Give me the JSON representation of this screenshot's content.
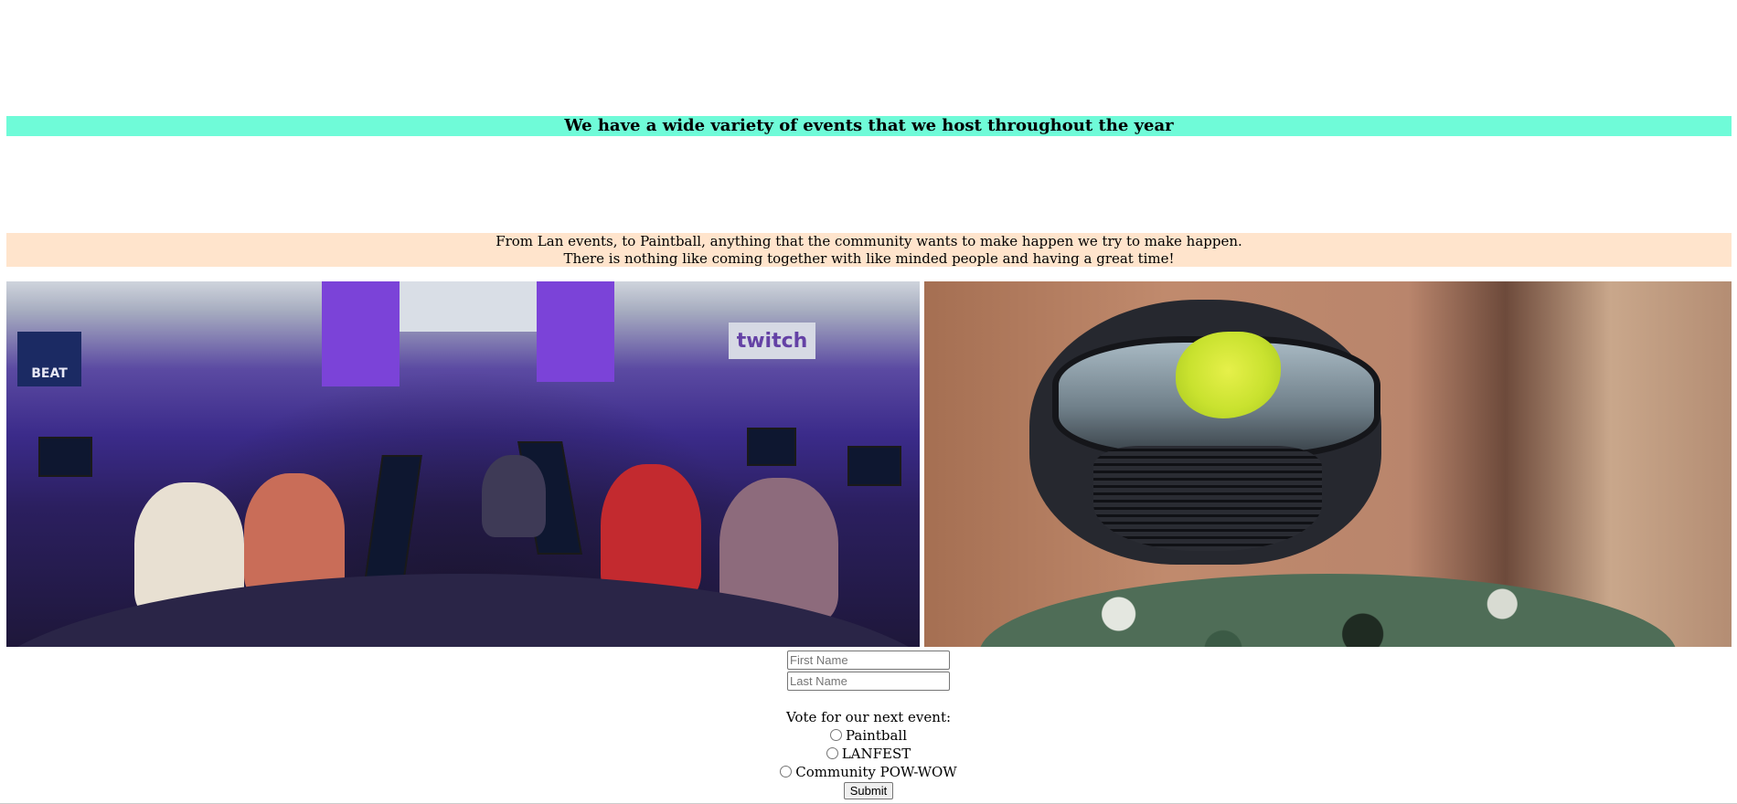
{
  "events": {
    "heading": "We have a wide variety of events that we host throughout the year",
    "intro_line_1": "From Lan events, to Paintball, anything that the community wants to make happen we try to make happen.",
    "intro_line_2": "There is nothing like coming together with like minded people and having a great time!",
    "heading_bg": "#6ffbd8",
    "intro_bg": "#ffe4cc"
  },
  "images": {
    "lan_photo": {
      "sign_twitch": "twitch",
      "sign_beat": "BEAT"
    },
    "paintball_photo": {}
  },
  "form": {
    "first_name_placeholder": "First Name",
    "last_name_placeholder": "Last Name",
    "question": "Vote for our next event:",
    "options": [
      "Paintball",
      "LANFEST",
      "Community POW-WOW"
    ],
    "submit_label": "Submit"
  }
}
